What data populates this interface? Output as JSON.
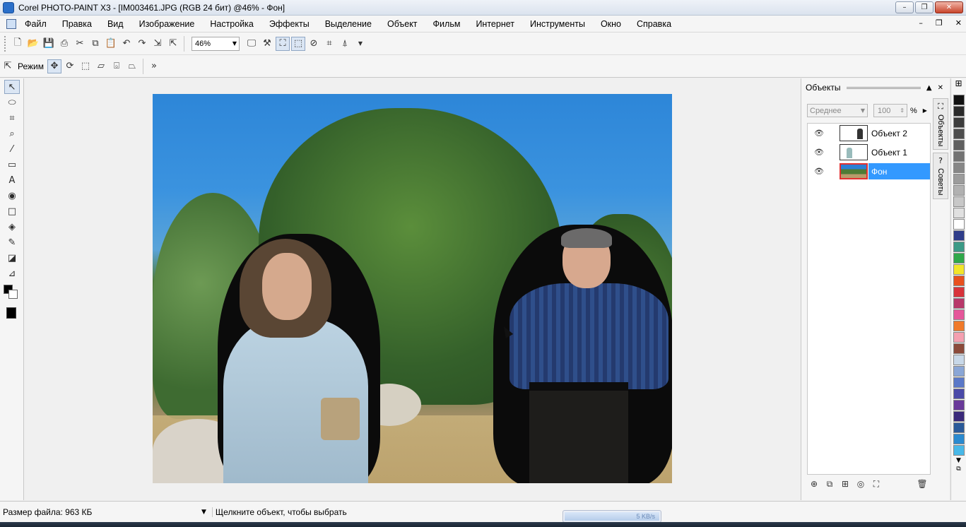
{
  "window": {
    "title": "Corel PHOTO-PAINT X3 - [IM003461.JPG (RGB 24 бит) @46% - Фон]",
    "controls": [
      "–",
      "❐",
      "✕"
    ]
  },
  "menu": {
    "items": [
      "Файл",
      "Правка",
      "Вид",
      "Изображение",
      "Настройка",
      "Эффекты",
      "Выделение",
      "Объект",
      "Фильм",
      "Интернет",
      "Инструменты",
      "Окно",
      "Справка"
    ],
    "mdi_controls": [
      "–",
      "❐",
      "✕"
    ]
  },
  "toolbar": {
    "zoom_value": "46%",
    "mode_label": "Режим"
  },
  "canvas": {
    "image_name": "IM003461.JPG",
    "zoom_percent": 46
  },
  "objects_docker": {
    "title": "Объекты",
    "merge_mode": "Среднее",
    "opacity": "100",
    "opacity_unit": "%",
    "objects": [
      {
        "name": "Объект 2",
        "visible": true,
        "selected": false
      },
      {
        "name": "Объект 1",
        "visible": true,
        "selected": false
      },
      {
        "name": "Фон",
        "visible": true,
        "selected": true
      }
    ],
    "tabs": [
      "Объекты",
      "Советы"
    ]
  },
  "palette": {
    "colors": [
      "#111111",
      "#2b2b2b",
      "#3c3c3c",
      "#4e4e4e",
      "#606060",
      "#737373",
      "#878787",
      "#9c9c9c",
      "#b1b1b1",
      "#c8c8c8",
      "#e0e0e0",
      "#ffffff",
      "#2f3d8a",
      "#3b9a86",
      "#2fa84a",
      "#f2e52a",
      "#e8501e",
      "#d8333a",
      "#b8386a",
      "#e5569a",
      "#f07a2a",
      "#f4a0b0",
      "#8b4a3a",
      "#c8d8e8",
      "#8aa6d6",
      "#5a78c8",
      "#4a4aa8",
      "#6a3a9a",
      "#3a2a7a",
      "#2a5a9a",
      "#2a8ad0",
      "#48b8e8"
    ]
  },
  "status": {
    "file_size": "Размер файла: 963 КБ",
    "hint": "Щелкните объект, чтобы выбрать",
    "network_speed": "5 KB/s"
  }
}
